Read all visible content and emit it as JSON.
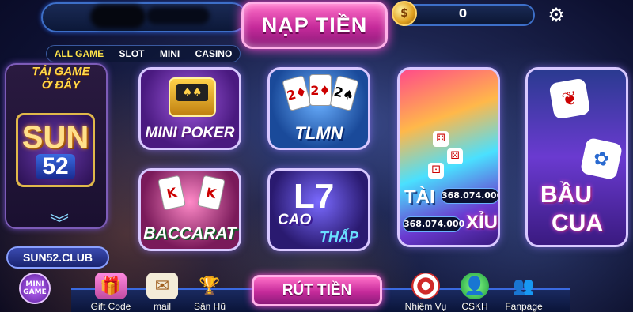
{
  "header": {
    "deposit_label": "NẠP TIỀN",
    "balance": "0"
  },
  "filter_tabs": [
    "ALL GAME",
    "SLOT",
    "MINI",
    "CASINO"
  ],
  "promo": {
    "download_label_line1": "TẢI GAME",
    "download_label_line2": "Ở ĐÂY",
    "logo_text": "SUN",
    "logo_number": "52",
    "site_label": "SUN52.CLUB",
    "mini_game_line1": "MINI",
    "mini_game_line2": "GAME"
  },
  "games": {
    "mini_poker": "MINI POKER",
    "tlmn": "TLMN",
    "baccarat": "BACCARAT",
    "cao_thap_line1": "CAO",
    "cao_thap_line2": "THẤP",
    "tai_label": "TÀI",
    "tai_value": "368.074.000",
    "xiu_label": "XỈU",
    "xiu_value": "368.074.000",
    "bau_label": "BẦU",
    "cua_label": "CUA"
  },
  "bottom_nav": {
    "gift_code": "Gift Code",
    "mail": "mail",
    "san_hu": "Săn Hũ",
    "withdraw": "RÚT TIỀN",
    "missions": "Nhiệm Vụ",
    "support": "CSKH",
    "fanpage": "Fanpage"
  }
}
